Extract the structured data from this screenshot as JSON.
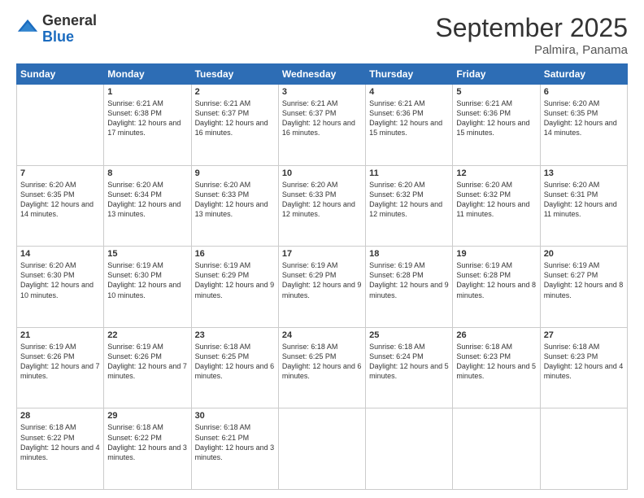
{
  "header": {
    "logo": {
      "general": "General",
      "blue": "Blue"
    },
    "title": "September 2025",
    "location": "Palmira, Panama"
  },
  "days_of_week": [
    "Sunday",
    "Monday",
    "Tuesday",
    "Wednesday",
    "Thursday",
    "Friday",
    "Saturday"
  ],
  "weeks": [
    [
      {
        "day": "",
        "info": ""
      },
      {
        "day": "1",
        "info": "Sunrise: 6:21 AM\nSunset: 6:38 PM\nDaylight: 12 hours\nand 17 minutes."
      },
      {
        "day": "2",
        "info": "Sunrise: 6:21 AM\nSunset: 6:37 PM\nDaylight: 12 hours\nand 16 minutes."
      },
      {
        "day": "3",
        "info": "Sunrise: 6:21 AM\nSunset: 6:37 PM\nDaylight: 12 hours\nand 16 minutes."
      },
      {
        "day": "4",
        "info": "Sunrise: 6:21 AM\nSunset: 6:36 PM\nDaylight: 12 hours\nand 15 minutes."
      },
      {
        "day": "5",
        "info": "Sunrise: 6:21 AM\nSunset: 6:36 PM\nDaylight: 12 hours\nand 15 minutes."
      },
      {
        "day": "6",
        "info": "Sunrise: 6:20 AM\nSunset: 6:35 PM\nDaylight: 12 hours\nand 14 minutes."
      }
    ],
    [
      {
        "day": "7",
        "info": "Sunrise: 6:20 AM\nSunset: 6:35 PM\nDaylight: 12 hours\nand 14 minutes."
      },
      {
        "day": "8",
        "info": "Sunrise: 6:20 AM\nSunset: 6:34 PM\nDaylight: 12 hours\nand 13 minutes."
      },
      {
        "day": "9",
        "info": "Sunrise: 6:20 AM\nSunset: 6:33 PM\nDaylight: 12 hours\nand 13 minutes."
      },
      {
        "day": "10",
        "info": "Sunrise: 6:20 AM\nSunset: 6:33 PM\nDaylight: 12 hours\nand 12 minutes."
      },
      {
        "day": "11",
        "info": "Sunrise: 6:20 AM\nSunset: 6:32 PM\nDaylight: 12 hours\nand 12 minutes."
      },
      {
        "day": "12",
        "info": "Sunrise: 6:20 AM\nSunset: 6:32 PM\nDaylight: 12 hours\nand 11 minutes."
      },
      {
        "day": "13",
        "info": "Sunrise: 6:20 AM\nSunset: 6:31 PM\nDaylight: 12 hours\nand 11 minutes."
      }
    ],
    [
      {
        "day": "14",
        "info": "Sunrise: 6:20 AM\nSunset: 6:30 PM\nDaylight: 12 hours\nand 10 minutes."
      },
      {
        "day": "15",
        "info": "Sunrise: 6:19 AM\nSunset: 6:30 PM\nDaylight: 12 hours\nand 10 minutes."
      },
      {
        "day": "16",
        "info": "Sunrise: 6:19 AM\nSunset: 6:29 PM\nDaylight: 12 hours\nand 9 minutes."
      },
      {
        "day": "17",
        "info": "Sunrise: 6:19 AM\nSunset: 6:29 PM\nDaylight: 12 hours\nand 9 minutes."
      },
      {
        "day": "18",
        "info": "Sunrise: 6:19 AM\nSunset: 6:28 PM\nDaylight: 12 hours\nand 9 minutes."
      },
      {
        "day": "19",
        "info": "Sunrise: 6:19 AM\nSunset: 6:28 PM\nDaylight: 12 hours\nand 8 minutes."
      },
      {
        "day": "20",
        "info": "Sunrise: 6:19 AM\nSunset: 6:27 PM\nDaylight: 12 hours\nand 8 minutes."
      }
    ],
    [
      {
        "day": "21",
        "info": "Sunrise: 6:19 AM\nSunset: 6:26 PM\nDaylight: 12 hours\nand 7 minutes."
      },
      {
        "day": "22",
        "info": "Sunrise: 6:19 AM\nSunset: 6:26 PM\nDaylight: 12 hours\nand 7 minutes."
      },
      {
        "day": "23",
        "info": "Sunrise: 6:18 AM\nSunset: 6:25 PM\nDaylight: 12 hours\nand 6 minutes."
      },
      {
        "day": "24",
        "info": "Sunrise: 6:18 AM\nSunset: 6:25 PM\nDaylight: 12 hours\nand 6 minutes."
      },
      {
        "day": "25",
        "info": "Sunrise: 6:18 AM\nSunset: 6:24 PM\nDaylight: 12 hours\nand 5 minutes."
      },
      {
        "day": "26",
        "info": "Sunrise: 6:18 AM\nSunset: 6:23 PM\nDaylight: 12 hours\nand 5 minutes."
      },
      {
        "day": "27",
        "info": "Sunrise: 6:18 AM\nSunset: 6:23 PM\nDaylight: 12 hours\nand 4 minutes."
      }
    ],
    [
      {
        "day": "28",
        "info": "Sunrise: 6:18 AM\nSunset: 6:22 PM\nDaylight: 12 hours\nand 4 minutes."
      },
      {
        "day": "29",
        "info": "Sunrise: 6:18 AM\nSunset: 6:22 PM\nDaylight: 12 hours\nand 3 minutes."
      },
      {
        "day": "30",
        "info": "Sunrise: 6:18 AM\nSunset: 6:21 PM\nDaylight: 12 hours\nand 3 minutes."
      },
      {
        "day": "",
        "info": ""
      },
      {
        "day": "",
        "info": ""
      },
      {
        "day": "",
        "info": ""
      },
      {
        "day": "",
        "info": ""
      }
    ]
  ]
}
